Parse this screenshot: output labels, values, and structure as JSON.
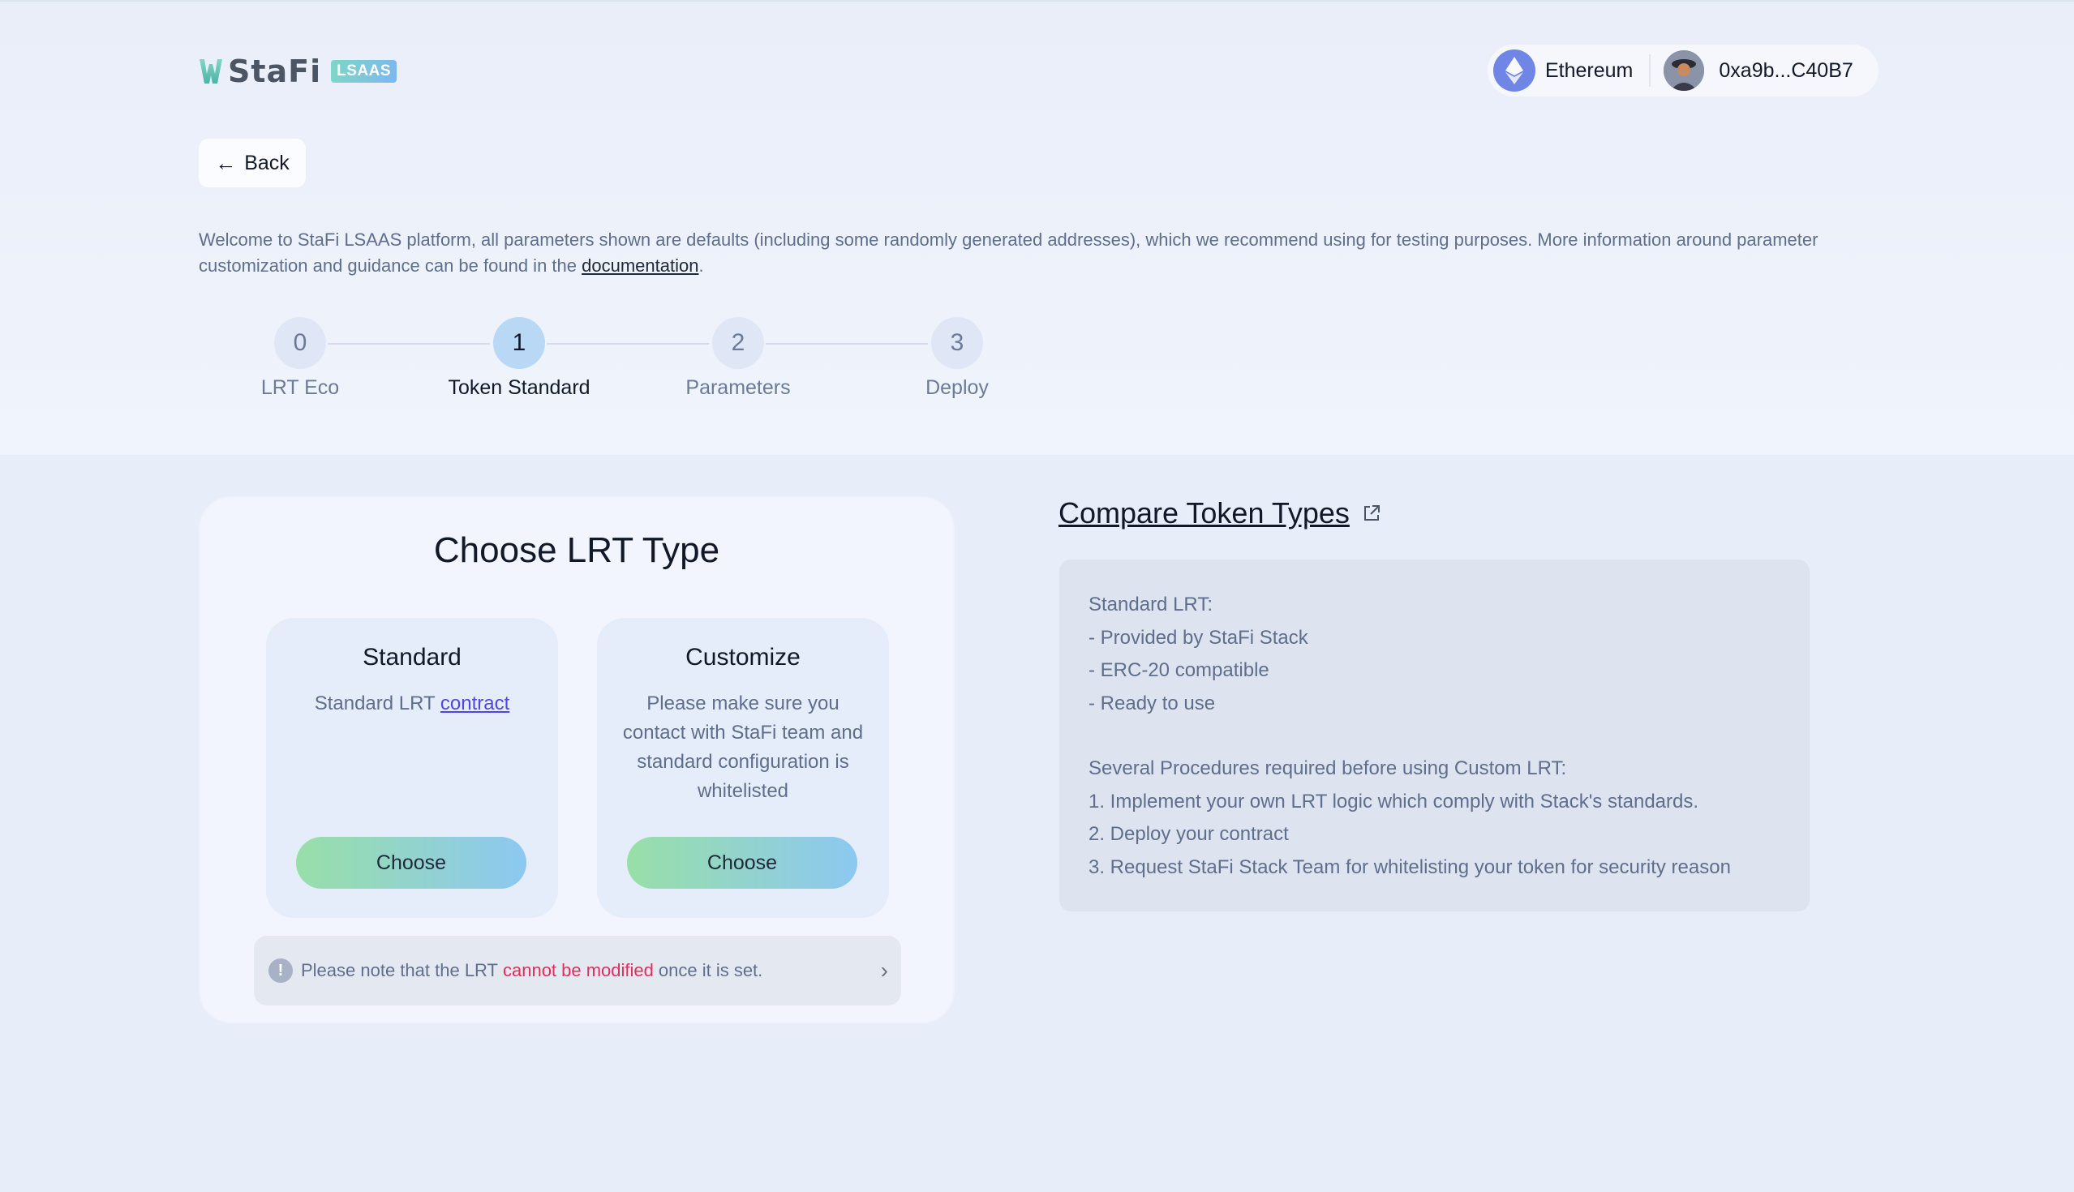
{
  "brand": {
    "name": "StaFi",
    "badge": "LSAAS",
    "colors": {
      "accent_start": "#98dfa8",
      "accent_end": "#8cc8f1",
      "warning": "#e02d5c"
    }
  },
  "header": {
    "network": "Ethereum",
    "network_icon": "ethereum-icon",
    "address": "0xa9b...C40B7"
  },
  "back": {
    "label": "Back",
    "icon": "arrow-left-icon"
  },
  "intro": {
    "text": "Welcome to StaFi LSAAS platform, all parameters shown are defaults (including some randomly generated addresses), which we recommend using for testing purposes. More information around parameter customization and guidance can be found in the ",
    "link": "documentation",
    "end": "."
  },
  "stepper": {
    "active": 1,
    "steps": [
      {
        "num": "0",
        "label": "LRT Eco"
      },
      {
        "num": "1",
        "label": "Token Standard"
      },
      {
        "num": "2",
        "label": "Parameters"
      },
      {
        "num": "3",
        "label": "Deploy"
      }
    ]
  },
  "card": {
    "title": "Choose LRT Type",
    "standard": {
      "title": "Standard",
      "desc": "Standard LRT ",
      "link": "contract",
      "button": "Choose"
    },
    "customize": {
      "title": "Customize",
      "desc": "Please make sure you contact with StaFi team and standard configuration is whitelisted",
      "button": "Choose"
    },
    "note": {
      "pre": "Please note that the LRT ",
      "warn": "cannot be modified",
      "post": " once it is set."
    }
  },
  "compare": {
    "title": "Compare Token Types",
    "standard_lines": [
      "Standard LRT:",
      "- Provided by StaFi Stack",
      "- ERC-20 compatible",
      "- Ready to use"
    ],
    "custom_lines": [
      "Several Procedures required before using Custom LRT:",
      "1. Implement your own LRT logic which comply with Stack's standards.",
      "2. Deploy your contract",
      "3. Request StaFi Stack Team for whitelisting your token for security reason"
    ]
  }
}
